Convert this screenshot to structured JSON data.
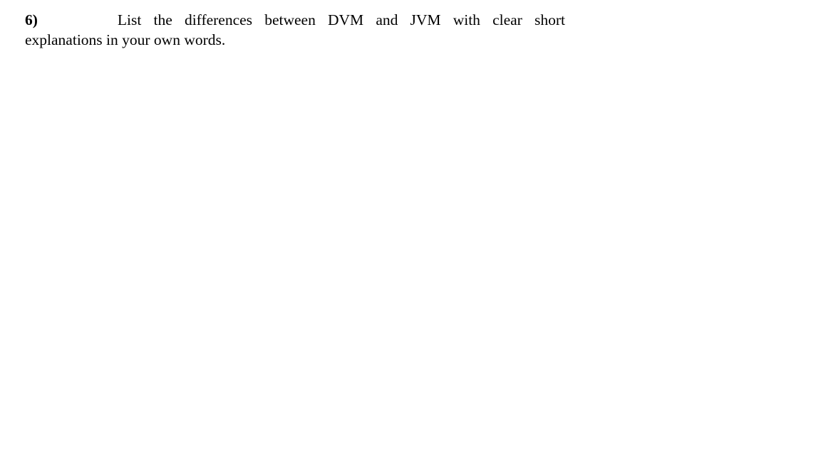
{
  "page": {
    "background_color": "#ffffff",
    "text_color": "#000000"
  },
  "document": {
    "questions": [
      {
        "marker": "6)",
        "text": "List the differences between DVM and JVM with clear short explanations in your own words.",
        "line1": "List the differences between DVM and JVM with clear short",
        "line2": "explanations in your own words."
      }
    ]
  }
}
